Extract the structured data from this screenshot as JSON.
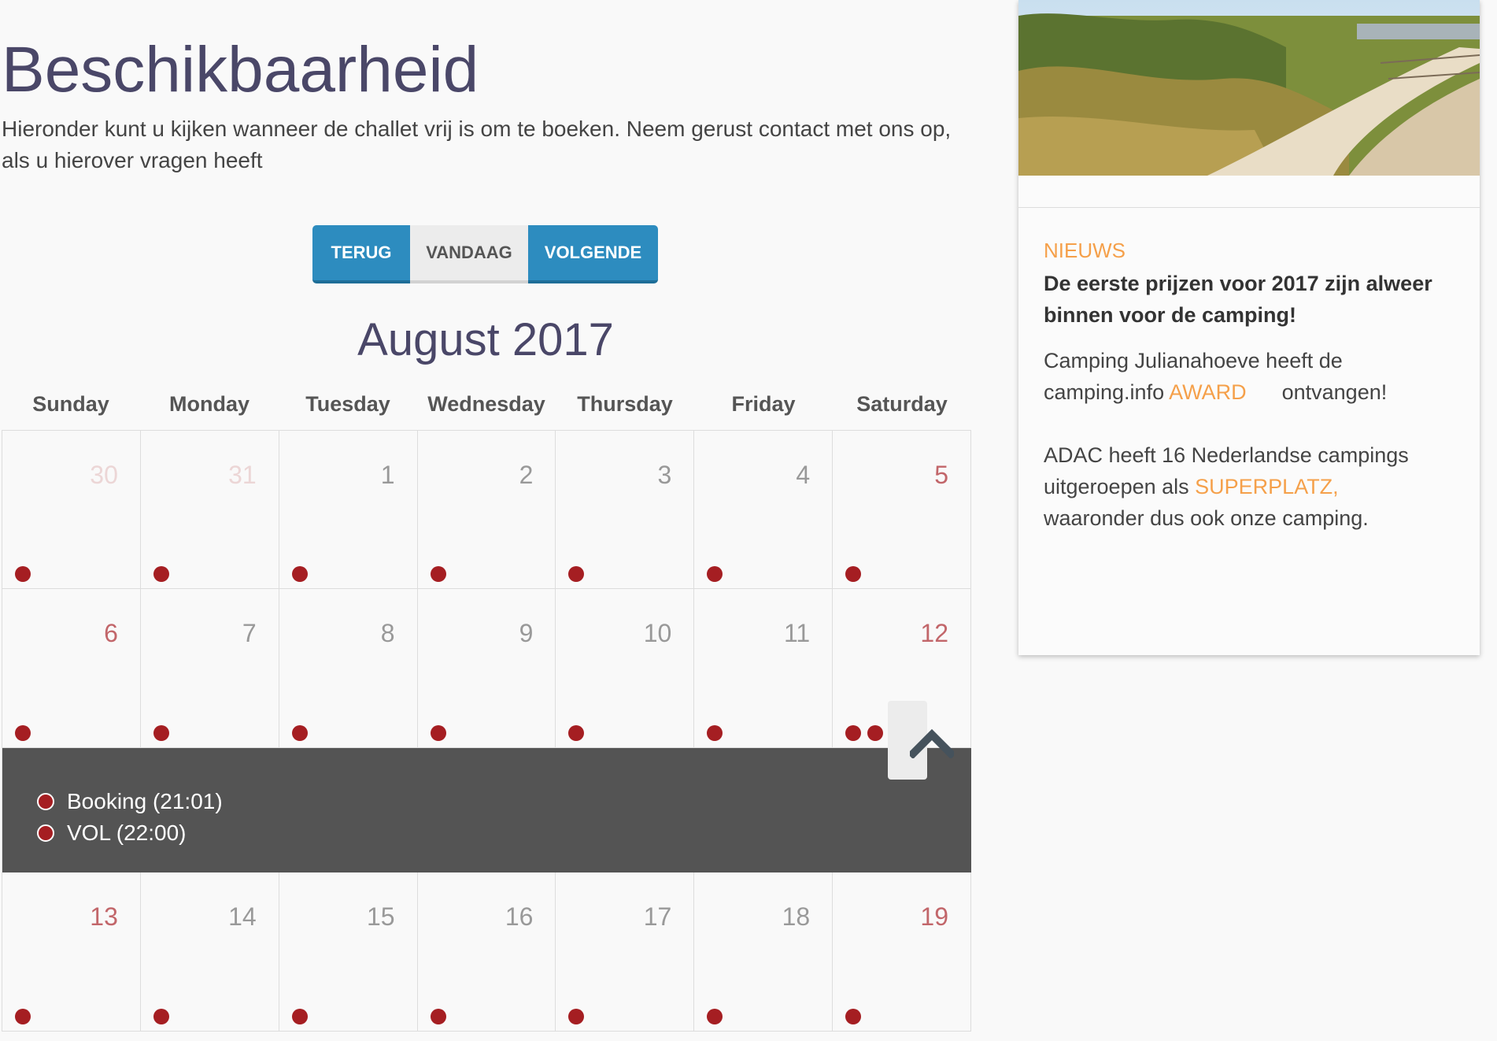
{
  "page": {
    "title": "Beschikbaarheid",
    "intro": "Hieronder kunt u kijken wanneer de challet vrij is om te boeken. Neem gerust contact met ons op, als u hierover vragen heeft"
  },
  "nav": {
    "prev": "TERUG",
    "today": "VANDAAG",
    "next": "VOLGENDE"
  },
  "calendar": {
    "month_label": "August 2017",
    "weekdays": [
      "Sunday",
      "Monday",
      "Tuesday",
      "Wednesday",
      "Thursday",
      "Friday",
      "Saturday"
    ],
    "weeks": [
      [
        "30",
        "31",
        "1",
        "2",
        "3",
        "4",
        "5"
      ],
      [
        "6",
        "7",
        "8",
        "9",
        "10",
        "11",
        "12"
      ],
      [
        "13",
        "14",
        "15",
        "16",
        "17",
        "18",
        "19"
      ]
    ],
    "expanded_events": [
      "Booking (21:01)",
      "VOL (22:00)"
    ]
  },
  "sidebar": {
    "news_label": "NIEUWS",
    "headline": "De eerste prijzen voor 2017 zijn alweer binnen voor de camping!",
    "p1_before": "Camping Julianahoeve heeft de camping.info ",
    "p1_link": "AWARD",
    "p1_after": "      ontvangen!",
    "p2_before": "ADAC heeft 16 Nederlandse campings uitgeroepen als ",
    "p2_link": "SUPERPLATZ,",
    "p2_after": "      waaronder dus ook onze camping."
  },
  "colors": {
    "accent": "#2d8cbf",
    "event_dot": "#a51e22",
    "news_orange": "#f5a04a",
    "title": "#4a4768"
  }
}
